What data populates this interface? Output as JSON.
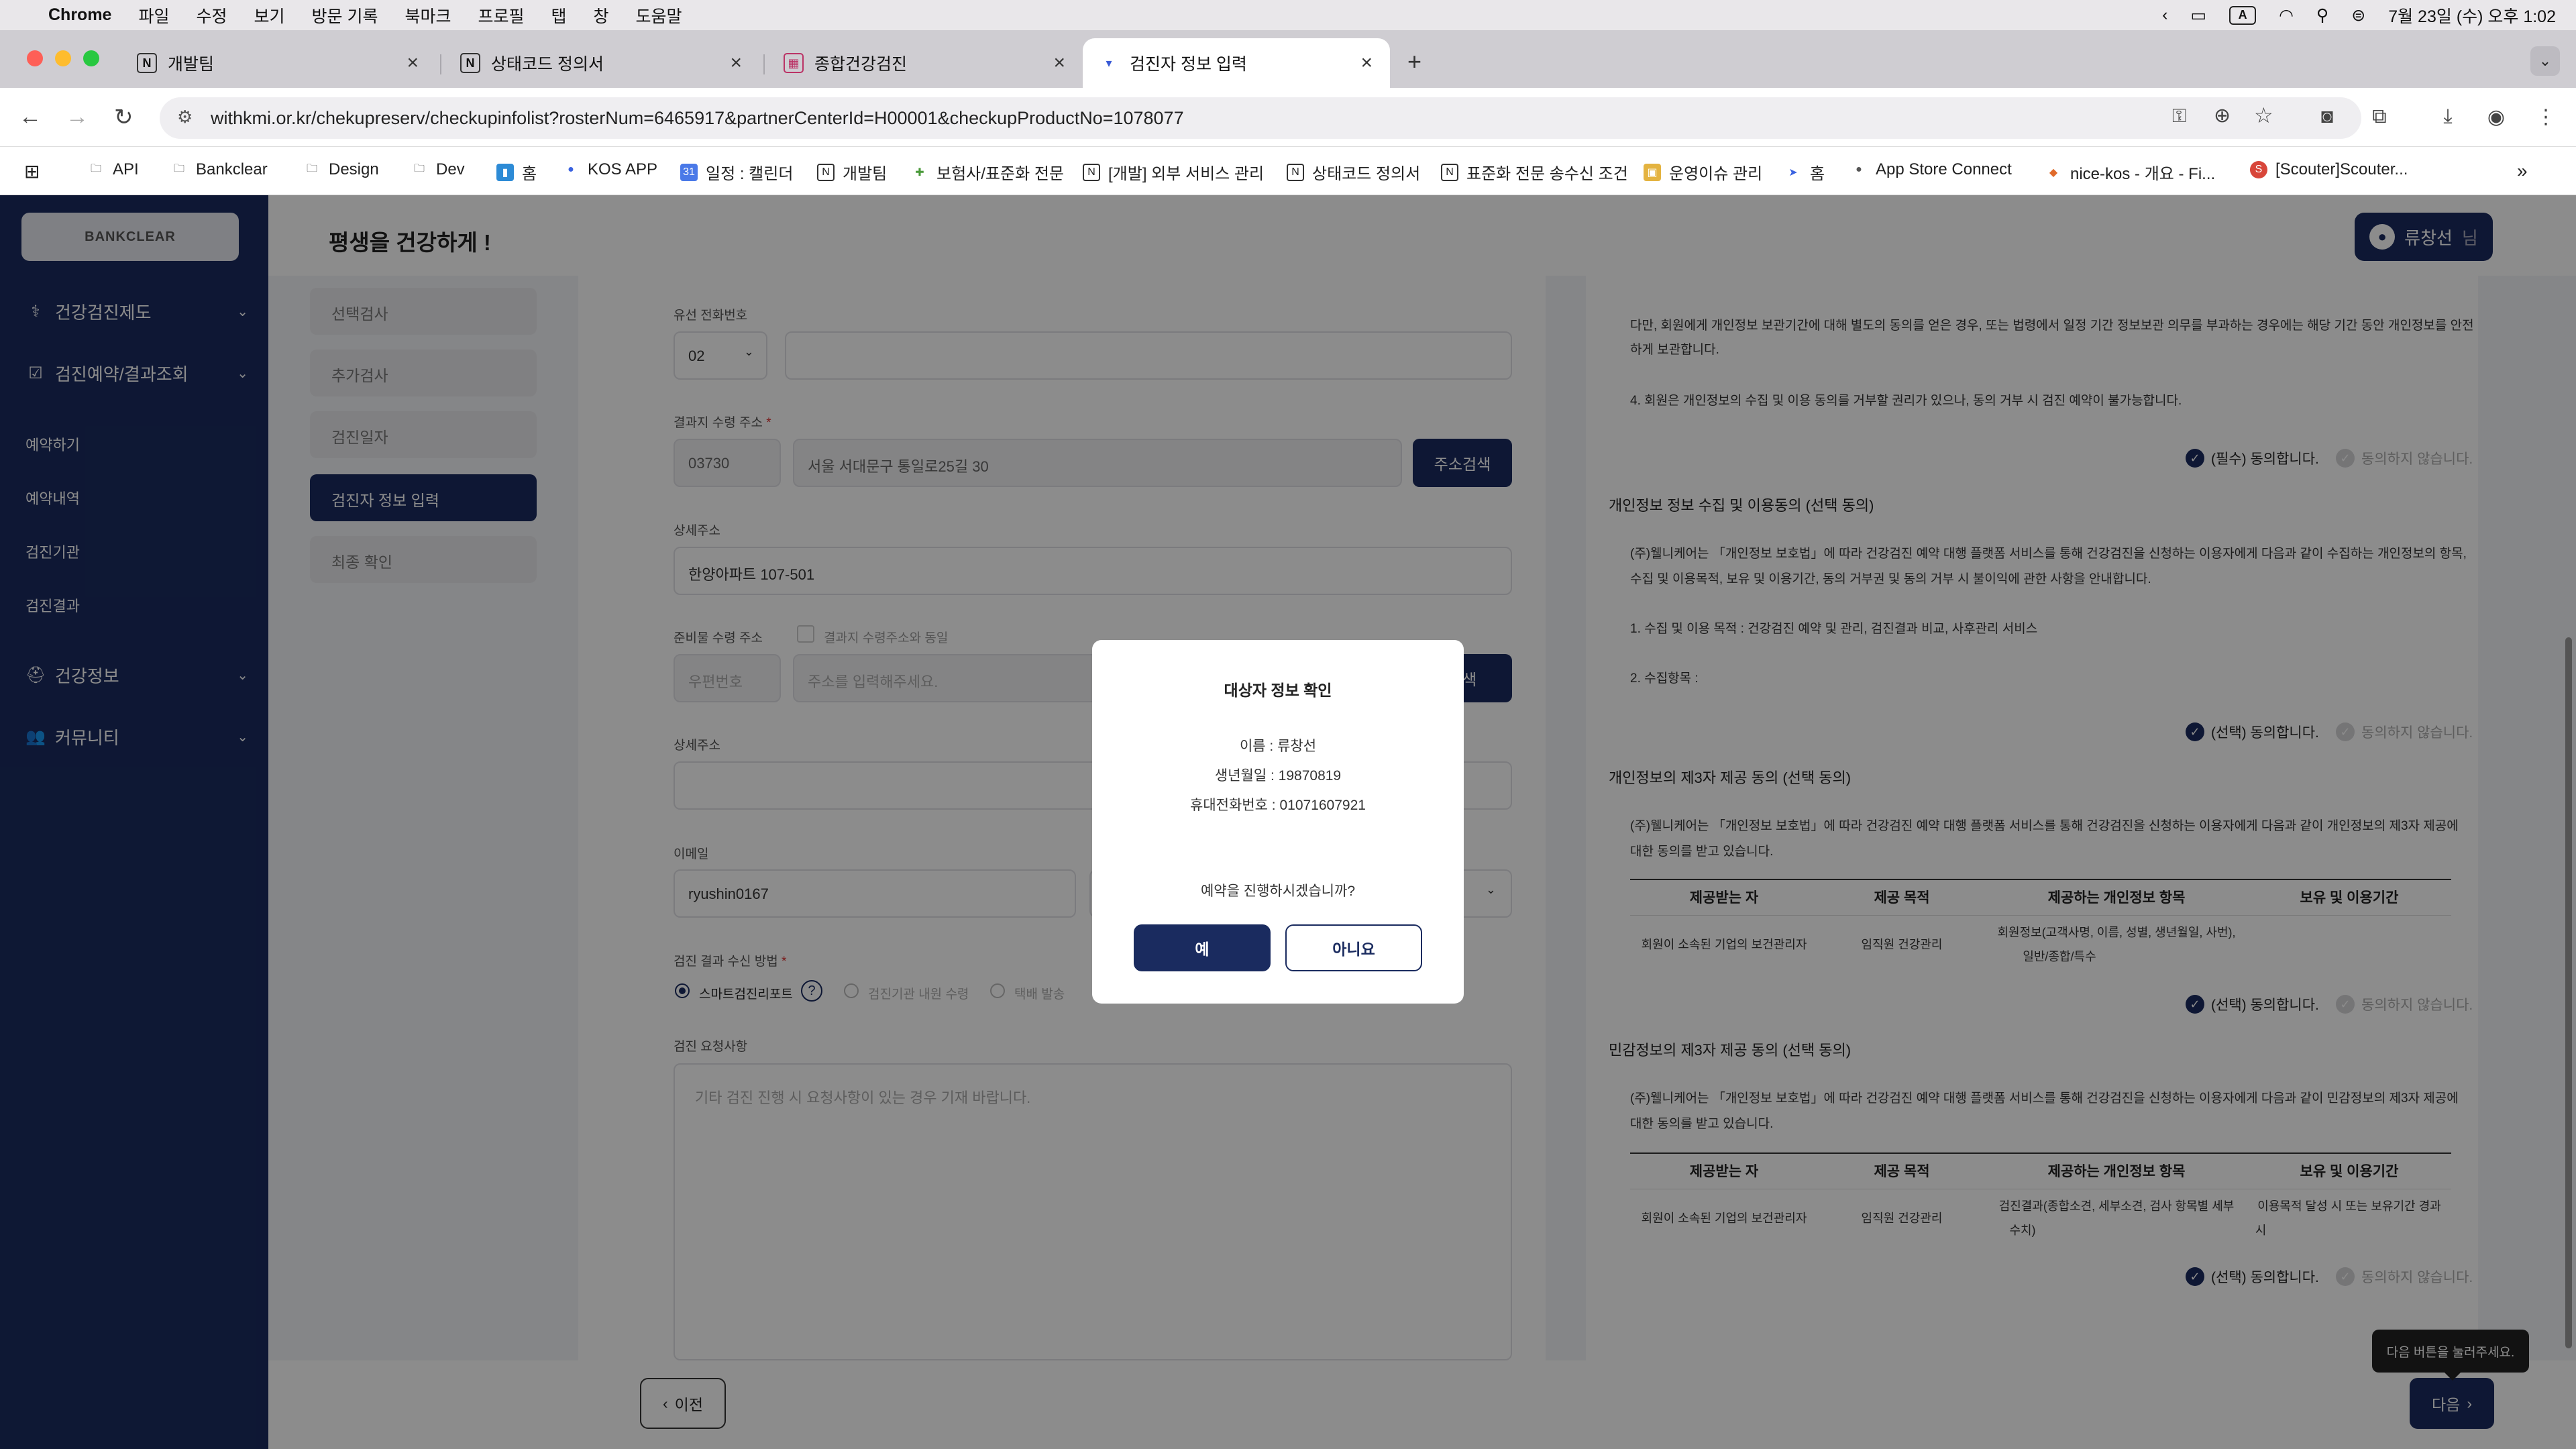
{
  "menubar": {
    "app": "Chrome",
    "items": [
      "파일",
      "수정",
      "보기",
      "방문 기록",
      "북마크",
      "프로필",
      "탭",
      "창",
      "도움말"
    ],
    "clock": "7월 23일 (수) 오후 1:02",
    "input_indicator": "A"
  },
  "tabs": [
    {
      "title": "개발팀",
      "icon": "notion-icon"
    },
    {
      "title": "상태코드 정의서",
      "icon": "notion-icon"
    },
    {
      "title": "종합건강검진",
      "icon": "hospital-icon"
    },
    {
      "title": "검진자 정보 입력",
      "icon": "site-icon",
      "active": true
    }
  ],
  "toolbar": {
    "url": "withkmi.or.kr/chekupreserv/checkupinfolist?rosterNum=6465917&partnerCenterId=H00001&checkupProductNo=1078077"
  },
  "bookmarks": [
    "API",
    "Bankclear",
    "Design",
    "Dev",
    "홈",
    "KOS APP",
    "일정 : 캘린더",
    "개발팀",
    "보험사/표준화 전문",
    "[개발] 외부 서비스 관리",
    "상태코드 정의서",
    "표준화 전문 송수신 조건",
    "운영이슈 관리",
    "홈",
    "App Store Connect",
    "nice-kos - 개요 - Fi...",
    "[Scouter]Scouter..."
  ],
  "sidebar": {
    "logo": "BANKCLEAR",
    "menus": [
      {
        "label": "건강검진제도"
      },
      {
        "label": "검진예약/결과조회"
      },
      {
        "label": "건강정보"
      },
      {
        "label": "커뮤니티"
      }
    ],
    "subs": [
      "예약하기",
      "예약내역",
      "검진기관",
      "검진결과"
    ]
  },
  "header": {
    "greeting": "평생을 건강하게 !",
    "user": "류창선",
    "user_suffix": "님"
  },
  "steps": [
    "선택검사",
    "추가검사",
    "검진일자",
    "검진자 정보 입력",
    "최종 확인"
  ],
  "form": {
    "phone_label": "유선 전화번호",
    "phone_prefix": "02",
    "result_addr_label": "결과지 수령 주소",
    "zipcode": "03730",
    "address": "서울 서대문구 통일로25길 30",
    "address_search": "주소검색",
    "detail_label": "상세주소",
    "detail_value": "한양아파트 107-501",
    "prep_addr_label": "준비물 수령 주소",
    "same_as_result": "결과지 수령주소와 동일",
    "zip_placeholder": "우편번호",
    "addr_placeholder": "주소를 입력해주세요.",
    "address_search2": "검색",
    "detail_label2": "상세주소",
    "email_label": "이메일",
    "email_value": "ryushin0167",
    "result_method_label": "검진 결과 수신 방법",
    "method_options": [
      "스마트검진리포트",
      "검진기관 내원 수령",
      "택배 발송"
    ],
    "request_label": "검진 요청사항",
    "request_placeholder": "기타 검진 진행 시 요청사항이 있는 경우 기재 바랍니다."
  },
  "terms": {
    "top_text_1": "다만, 회원에게 개인정보 보관기간에 대해 별도의 동의를 얻은 경우, 또는 법령에서 일정 기간 정보보관 의무를 부과하는 경우에는 해당 기간 동안 개인정보를 안전",
    "top_text_2": "하게 보관합니다.",
    "top_text_3": "4. 회원은 개인정보의 수집 및 이용 동의를 거부할 권리가 있으나, 동의 거부 시 검진 예약이 불가능합니다.",
    "agree_required": "(필수) 동의합니다.",
    "agree_optional": "(선택) 동의합니다.",
    "disagree": "동의하지 않습니다.",
    "s2_title": "개인정보 정보 수집 및 이용동의 (선택 동의)",
    "s2_text_1": "(주)웰니케어는 「개인정보 보호법」에 따라 건강검진 예약 대행 플랫폼 서비스를 통해 건강검진을 신청하는 이용자에게 다음과 같이 수집하는 개인정보의 항목,",
    "s2_text_2": "수집 및 이용목적, 보유 및 이용기간, 동의 거부권 및 동의 거부 시 불이익에 관한 사항을 안내합니다.",
    "s2_text_3": "1. 수집 및 이용 목적 : 건강검진 예약 및 관리, 검진결과 비교, 사후관리 서비스",
    "s2_text_4": "2. 수집항목 :",
    "s3_title": "개인정보의 제3자 제공 동의 (선택 동의)",
    "s3_text_1": "(주)웰니케어는 「개인정보 보호법」에 따라 건강검진 예약 대행 플랫폼 서비스를 통해 건강검진을 신청하는 이용자에게 다음과 같이 개인정보의 제3자 제공에",
    "s3_text_2": "대한 동의를 받고 있습니다.",
    "table_headers": [
      "제공받는 자",
      "제공 목적",
      "제공하는 개인정보 항목",
      "보유 및 이용기간"
    ],
    "t1_row": [
      "회원이 소속된 기업의 보건관리자",
      "임직원 건강관리",
      "회원정보(고객사명, 이름, 성별, 생년월일, 사번),",
      "일반/종합/특수"
    ],
    "s4_title": "민감정보의 제3자 제공 동의 (선택 동의)",
    "s4_text_1": "(주)웰니케어는 「개인정보 보호법」에 따라 건강검진 예약 대행 플랫폼 서비스를 통해 건강검진을 신청하는 이용자에게 다음과 같이 민감정보의 제3자 제공에",
    "s4_text_2": "대한 동의를 받고 있습니다.",
    "t2_row": [
      "회원이 소속된 기업의 보건관리자",
      "임직원 건강관리",
      "검진결과(종합소견, 세부소견, 검사 항목별 세부",
      "수치)",
      "이용목적 달성 시 또는 보유기간 경과",
      "시"
    ]
  },
  "bottom": {
    "prev": "이전",
    "next": "다음",
    "tooltip": "다음 버튼을 눌러주세요."
  },
  "modal": {
    "title": "대상자 정보 확인",
    "name": "이름 : 류창선",
    "birth": "생년월일 : 19870819",
    "phone": "휴대전화번호 : 01071607921",
    "question": "예약을 진행하시겠습니까?",
    "yes": "예",
    "no": "아니요"
  },
  "colors": {
    "brand_navy": "#1a2b5f",
    "overlay": "rgba(0,0,0,0.45)"
  }
}
